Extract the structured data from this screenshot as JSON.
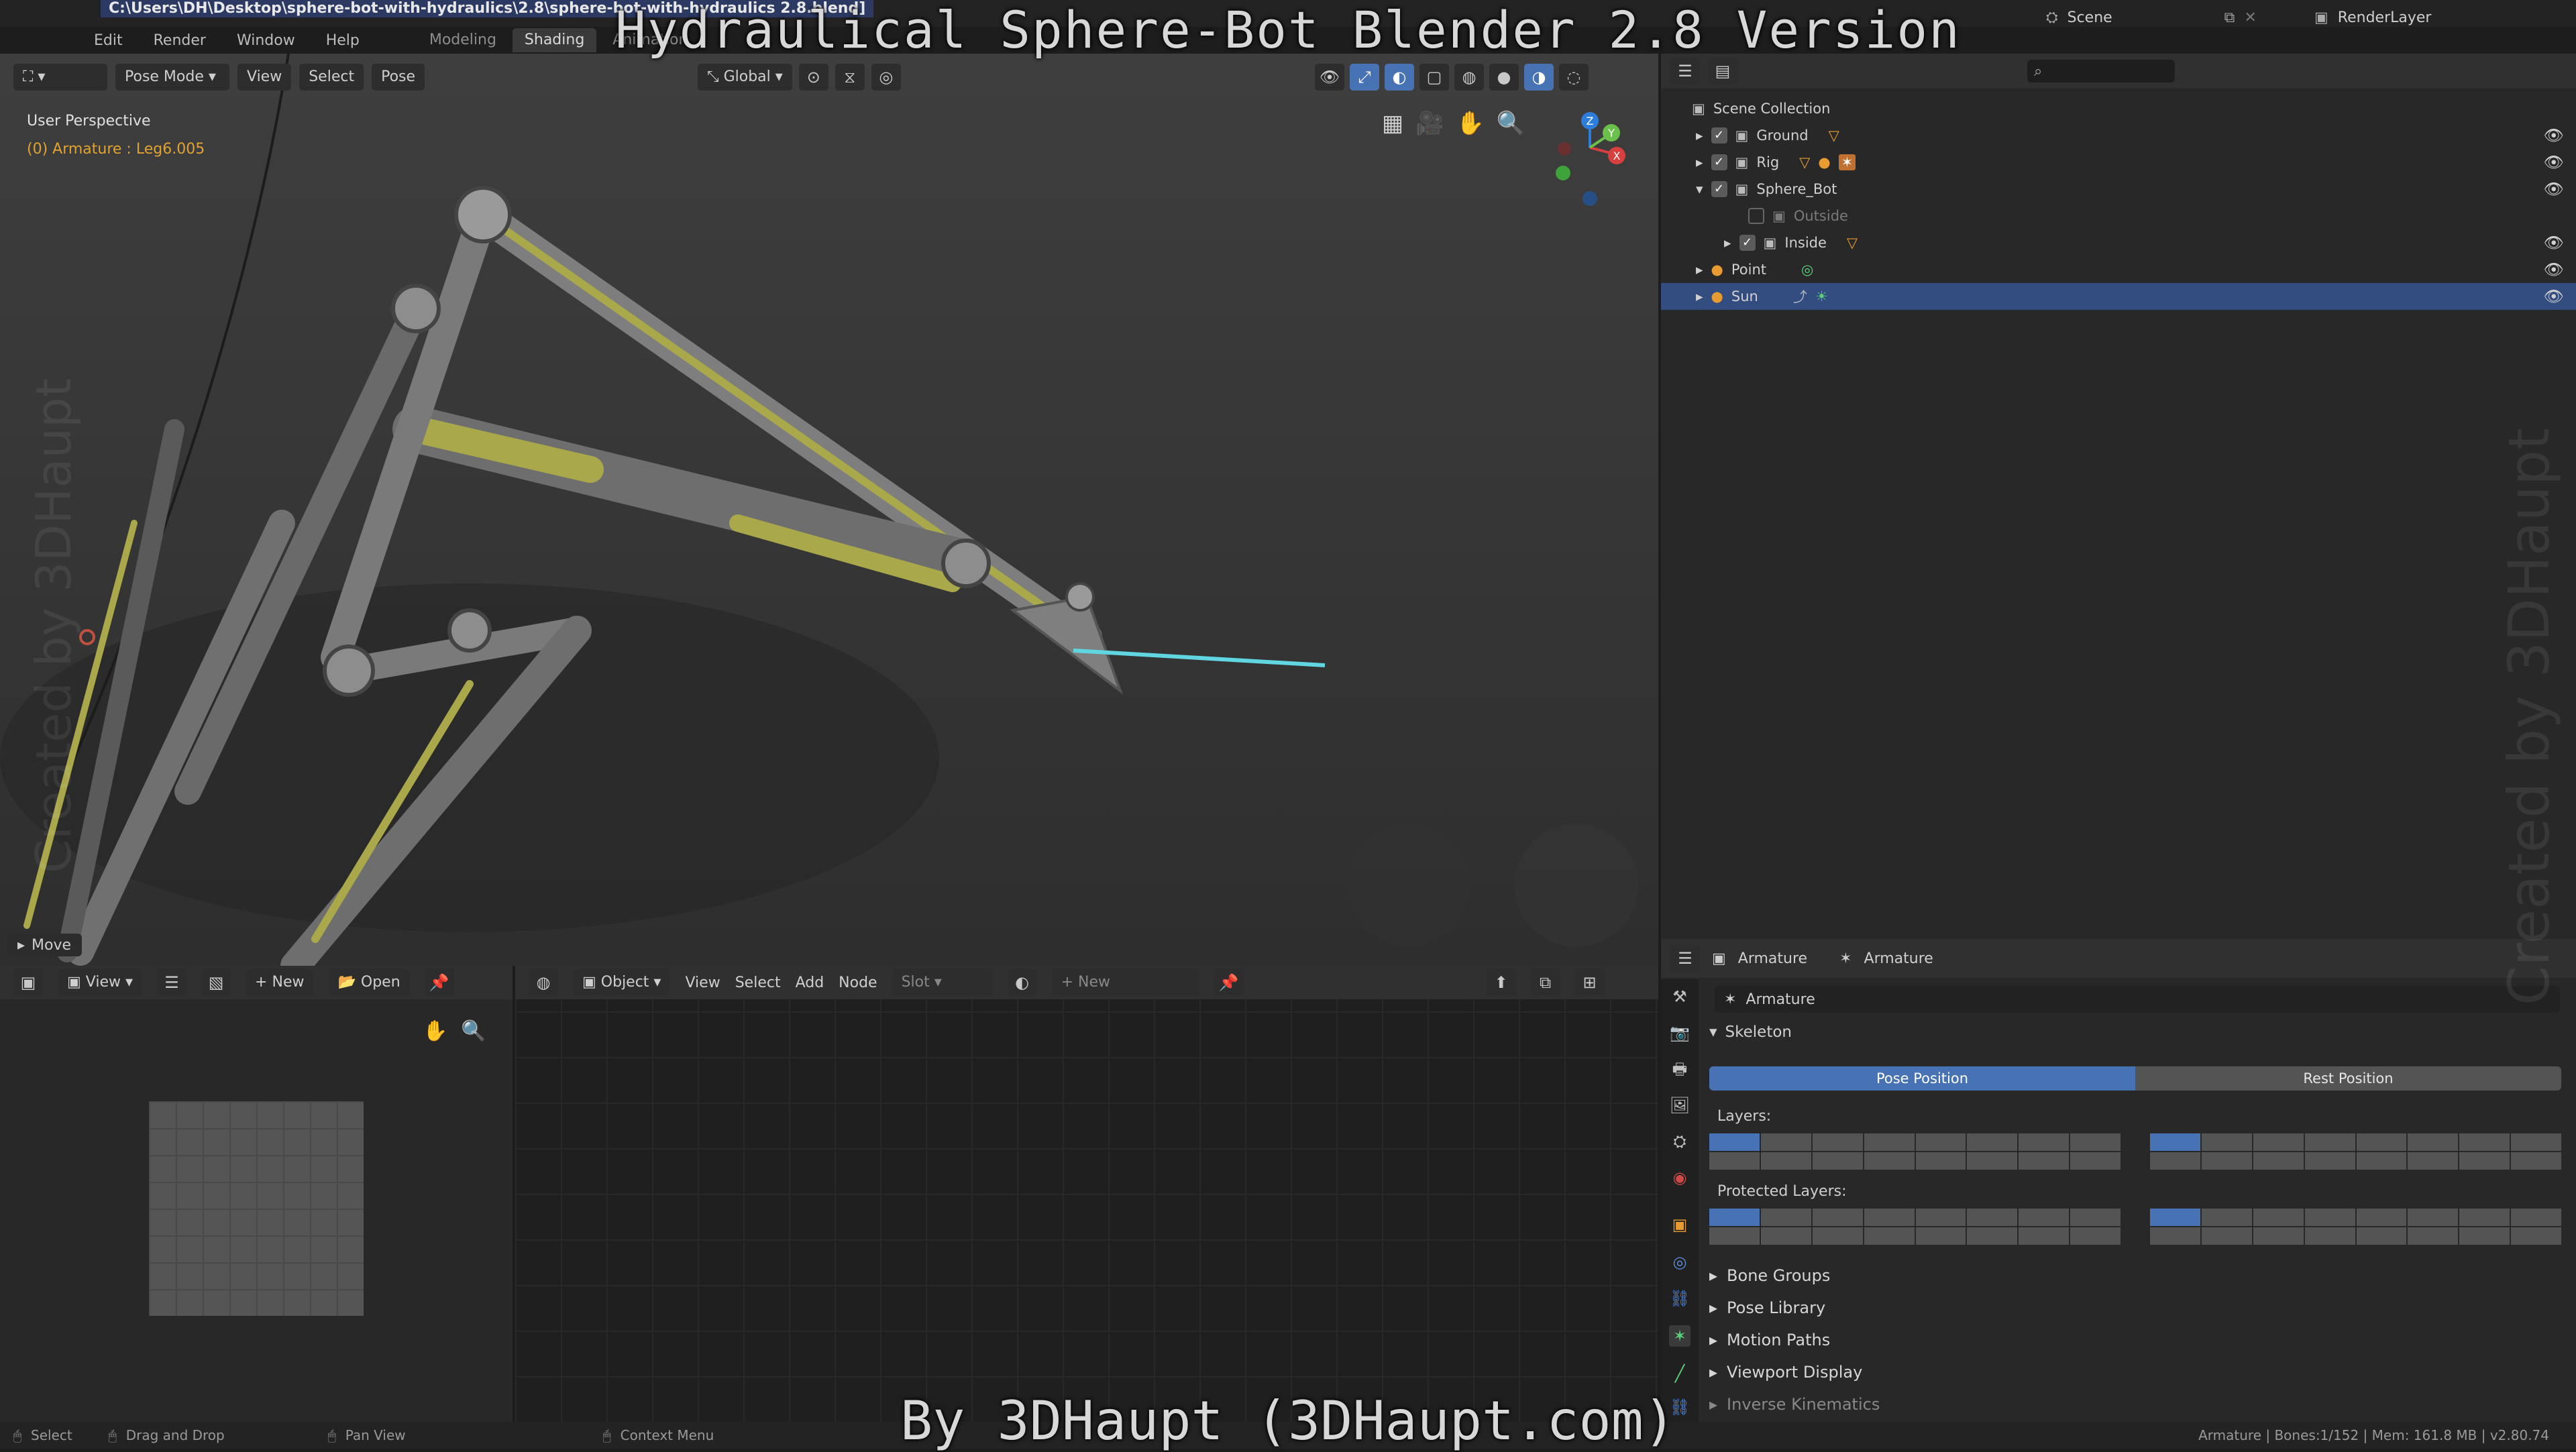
{
  "overlay": {
    "title": "Hydraulical Sphere-Bot Blender 2.8 Version",
    "credit": "By 3DHaupt (3DHaupt.com)",
    "watermark": "Created by 3DHaupt"
  },
  "topbar": {
    "file_path": "C:\\Users\\DH\\Desktop\\sphere-bot-with-hydraulics\\2.8\\sphere-bot-with-hydraulics 2.8.blend]",
    "menus": [
      "Edit",
      "Render",
      "Window",
      "Help"
    ],
    "workspaces": [
      "Modeling",
      "Shading",
      "Animation"
    ],
    "active_workspace": "Shading",
    "scene": "Scene",
    "view_layer": "RenderLayer"
  },
  "viewport": {
    "mode": "Pose Mode",
    "menus": [
      "View",
      "Select",
      "Pose"
    ],
    "orientation": "Global",
    "perspective": "User Perspective",
    "active_object": "(0) Armature : Leg6.005",
    "last_operator": "Move"
  },
  "outliner": {
    "root": "Scene Collection",
    "items": [
      {
        "label": "Ground",
        "depth": 1,
        "checked": true,
        "expanded": false,
        "selected": false
      },
      {
        "label": "Rig",
        "depth": 1,
        "checked": true,
        "expanded": false,
        "selected": false
      },
      {
        "label": "Sphere_Bot",
        "depth": 1,
        "checked": true,
        "expanded": true,
        "selected": false
      },
      {
        "label": "Outside",
        "depth": 2,
        "checked": false,
        "expanded": false,
        "selected": false
      },
      {
        "label": "Inside",
        "depth": 2,
        "checked": true,
        "expanded": false,
        "selected": false
      },
      {
        "label": "Point",
        "depth": 1,
        "checked": null,
        "expanded": false,
        "selected": false
      },
      {
        "label": "Sun",
        "depth": 1,
        "checked": null,
        "expanded": false,
        "selected": true
      }
    ]
  },
  "image_editor": {
    "menus": [
      "View"
    ],
    "new_label": "New",
    "open_label": "Open"
  },
  "node_editor": {
    "object_label": "Object",
    "menus": [
      "View",
      "Select",
      "Add",
      "Node"
    ],
    "slot_label": "Slot",
    "new_label": "New"
  },
  "properties": {
    "breadcrumb_1": "Armature",
    "breadcrumb_2": "Armature",
    "datablock": "Armature",
    "skeleton_label": "Skeleton",
    "pose_position": "Pose Position",
    "rest_position": "Rest Position",
    "layers_label": "Layers:",
    "protected_layers_label": "Protected Layers:",
    "panels": [
      "Bone Groups",
      "Pose Library",
      "Motion Paths",
      "Viewport Display",
      "Inverse Kinematics"
    ]
  },
  "statusbar": {
    "select": "Select",
    "drag": "Drag and Drop",
    "pan": "Pan View",
    "context": "Context Menu",
    "stats": "Armature | Bones:1/152 | Mem: 161.8 MB | v2.80.74"
  },
  "colors": {
    "accent": "#4772b3",
    "selection": "#334d80",
    "bone_highlight": "#5fd6e0",
    "hydraulic": "#a9a84a"
  }
}
